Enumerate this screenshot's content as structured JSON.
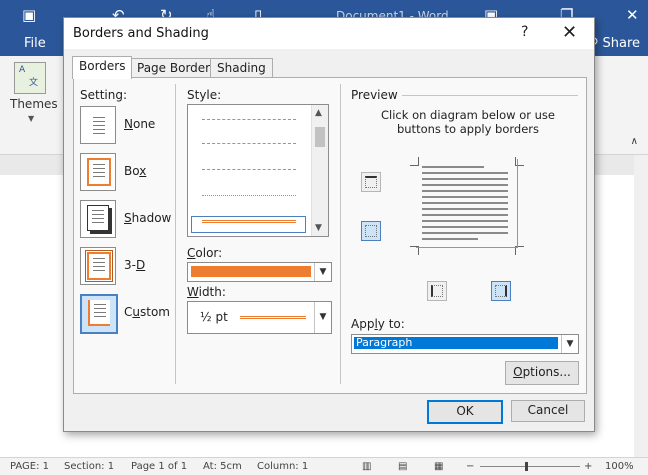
{
  "word": {
    "document_title": "Document1 - Word",
    "file_tab": "File",
    "share_label": "Share",
    "themes_label": "Themes",
    "statusbar": {
      "page": "PAGE: 1",
      "section": "Section: 1",
      "page_of": "Page 1 of 1",
      "at": "At: 5cm",
      "column": "Column: 1",
      "zoom": "100%"
    }
  },
  "dialog": {
    "title": "Borders and Shading",
    "help": "?",
    "close": "✕",
    "tabs": [
      {
        "label": "Borders",
        "active": true
      },
      {
        "label": "Page Border",
        "active": false
      },
      {
        "label": "Shading",
        "active": false
      }
    ],
    "setting": {
      "label": "Setting:",
      "items": [
        {
          "label": "None",
          "selected": false
        },
        {
          "label": "Box",
          "selected": false
        },
        {
          "label": "Shadow",
          "selected": false
        },
        {
          "label": "3-D",
          "selected": false
        },
        {
          "label": "Custom",
          "selected": true
        }
      ]
    },
    "style": {
      "label": "Style:",
      "selected_index": 4
    },
    "color": {
      "label": "Color:",
      "value": "#ED7D31"
    },
    "width": {
      "label": "Width:",
      "value": "½ pt"
    },
    "preview": {
      "label": "Preview",
      "hint": "Click on diagram below or use buttons to apply borders"
    },
    "apply_to": {
      "label": "Apply to:",
      "value": "Paragraph"
    },
    "options_button": "Options...",
    "ok_button": "OK",
    "cancel_button": "Cancel"
  },
  "colors": {
    "accent": "#2B579A",
    "border_orange": "#ED7D31",
    "selection_blue": "#0078D7"
  }
}
